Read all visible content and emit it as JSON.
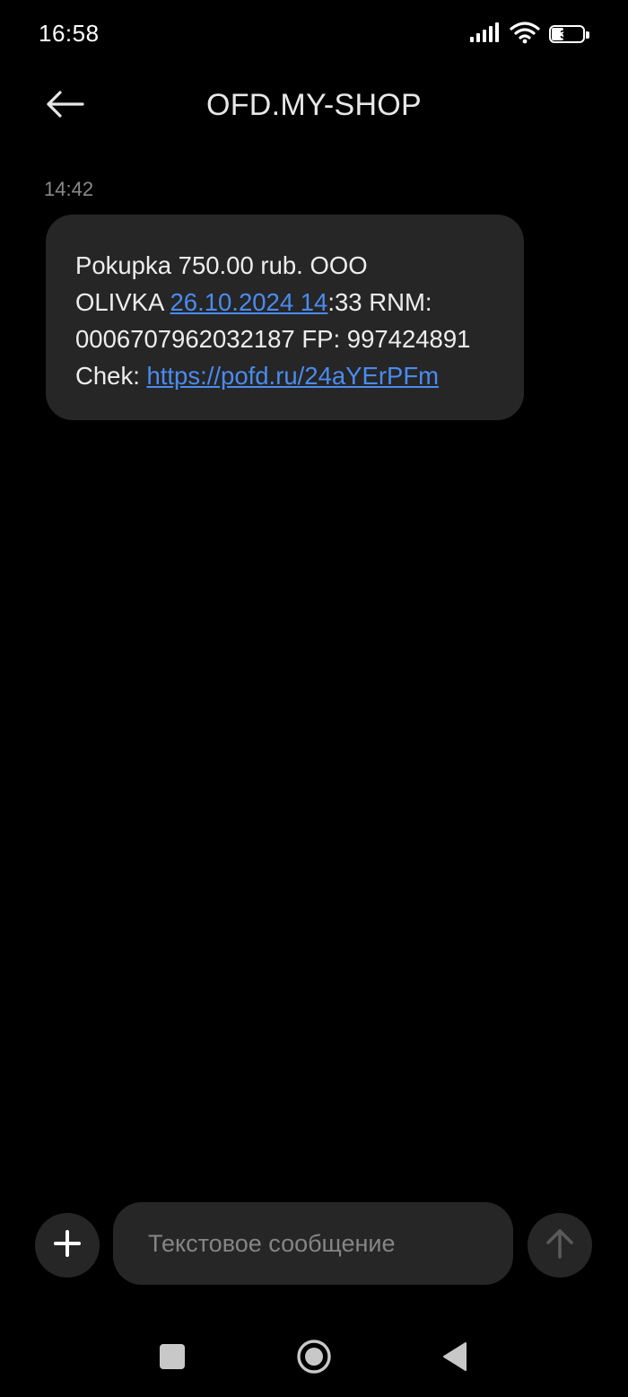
{
  "status_bar": {
    "time": "16:58",
    "battery_level": "38",
    "icons": [
      "signal-icon",
      "wifi-icon",
      "battery-icon"
    ]
  },
  "header": {
    "title": "OFD.MY-SHOP",
    "back_icon": "arrow-left-icon"
  },
  "messages": [
    {
      "time": "14:42",
      "line1": "Pokupka 750.00 rub. OOO",
      "line2_prefix": "OLIVKA ",
      "line2_link": "26.10.2024 14",
      "line2_suffix": ":33 RNM:",
      "line3": "0006707962032187 FP: 997424891",
      "line4_prefix": "Chek: ",
      "line4_link": "https://pofd.ru/24aYErPFm"
    }
  ],
  "composer": {
    "attach_icon": "plus-icon",
    "placeholder": "Текстовое сообщение",
    "send_icon": "arrow-up-icon"
  },
  "nav_bar": {
    "icons": [
      "recents-square-icon",
      "home-circle-icon",
      "back-triangle-icon"
    ]
  },
  "colors": {
    "background": "#000000",
    "bubble": "#262626",
    "link": "#4a8bf0",
    "muted_text": "#8a8a8a"
  }
}
